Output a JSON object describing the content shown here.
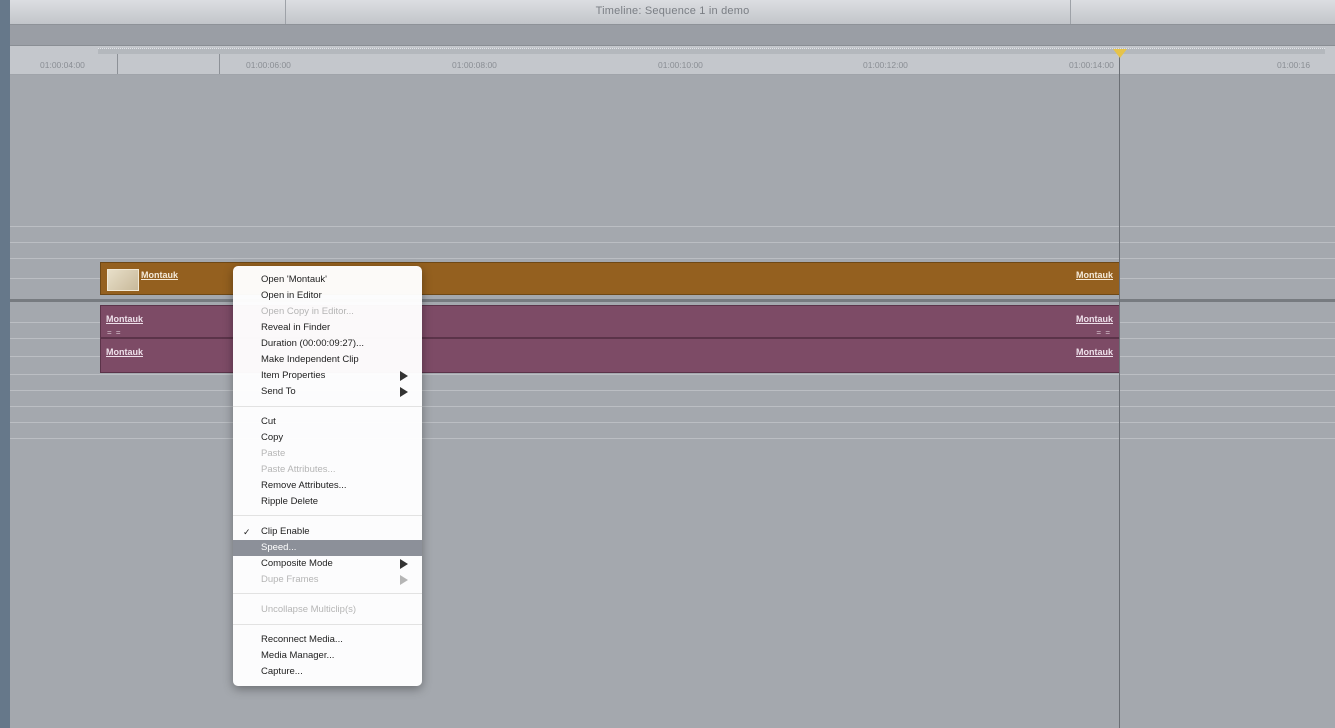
{
  "window": {
    "title": "Timeline: Sequence 1 in demo"
  },
  "ruler": {
    "timecodes": [
      "01:00:04:00",
      "01:00:06:00",
      "01:00:08:00",
      "01:00:10:00",
      "01:00:12:00",
      "01:00:14:00",
      "01:00:16"
    ]
  },
  "timeline": {
    "video_clip": {
      "name_start": "Montauk",
      "name_end": "Montauk"
    },
    "audio_clips": {
      "top_start": "Montauk",
      "top_end": "Montauk",
      "bottom_start": "Montauk",
      "bottom_end": "Montauk",
      "link_indicator": "= =",
      "link_indicator_end": "= ="
    }
  },
  "context_menu": {
    "group1": [
      {
        "label": "Open 'Montauk'",
        "enabled": true
      },
      {
        "label": "Open in Editor",
        "enabled": true
      },
      {
        "label": "Open Copy in Editor...",
        "enabled": false
      },
      {
        "label": "Reveal in Finder",
        "enabled": true
      },
      {
        "label": "Duration (00:00:09:27)...",
        "enabled": true
      },
      {
        "label": "Make Independent Clip",
        "enabled": true
      },
      {
        "label": "Item Properties",
        "enabled": true,
        "submenu": true
      },
      {
        "label": "Send To",
        "enabled": true,
        "submenu": true
      }
    ],
    "group2": [
      {
        "label": "Cut",
        "enabled": true
      },
      {
        "label": "Copy",
        "enabled": true
      },
      {
        "label": "Paste",
        "enabled": false
      },
      {
        "label": "Paste Attributes...",
        "enabled": false
      },
      {
        "label": "Remove Attributes...",
        "enabled": true
      },
      {
        "label": "Ripple Delete",
        "enabled": true
      }
    ],
    "group3": [
      {
        "label": "Clip Enable",
        "enabled": true,
        "checked": true,
        "check_mark": "✓"
      },
      {
        "label": "Speed...",
        "enabled": true,
        "highlighted": true
      },
      {
        "label": "Composite Mode",
        "enabled": true,
        "submenu": true
      },
      {
        "label": "Dupe Frames",
        "enabled": false,
        "submenu": true
      }
    ],
    "group4": [
      {
        "label": "Uncollapse Multiclip(s)",
        "enabled": false
      }
    ],
    "group5": [
      {
        "label": "Reconnect Media...",
        "enabled": true
      },
      {
        "label": "Media Manager...",
        "enabled": true
      },
      {
        "label": "Capture...",
        "enabled": true
      }
    ]
  },
  "colors": {
    "video_clip": "#94601f",
    "audio_clip": "#7d4b66",
    "menu_highlight": "#8c9099",
    "playhead_cap": "#e6c34a"
  }
}
